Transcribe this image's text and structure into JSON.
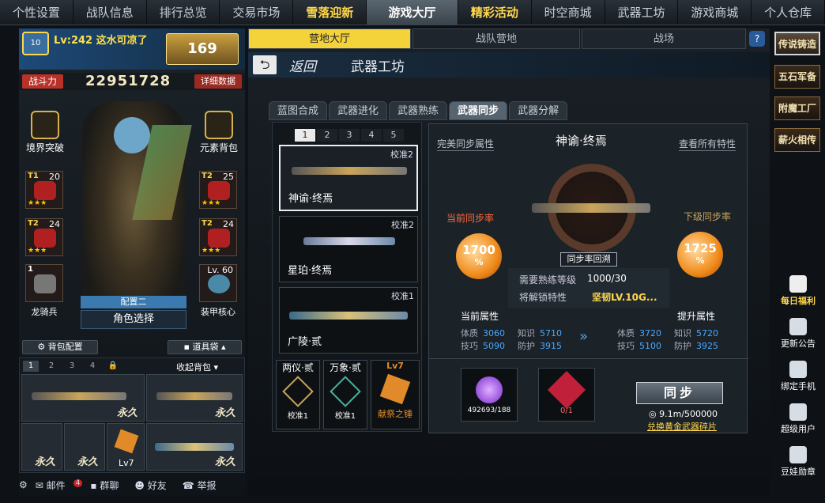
{
  "top_nav": [
    "个性设置",
    "战队信息",
    "排行总览",
    "交易市场",
    "雪落迎新",
    "游戏大厅",
    "精彩活动",
    "时空商城",
    "武器工坊",
    "游戏商城",
    "个人仓库"
  ],
  "player": {
    "level_name": "Lv:242 这水可凉了",
    "rank_num": "10",
    "military": "169",
    "power_label": "战斗力",
    "power_value": "22951728",
    "detail_btn": "详细数据"
  },
  "left_icons": {
    "realm": "境界突破",
    "element": "元素背包"
  },
  "armor_slots": [
    {
      "tier": "T1",
      "num": "20",
      "stars": "★★★"
    },
    {
      "tier": "T2",
      "num": "25",
      "stars": "★★★"
    },
    {
      "tier": "T2",
      "num": "24",
      "stars": "★★★"
    },
    {
      "tier": "T2",
      "num": "24",
      "stars": "★★★"
    }
  ],
  "dragon_rider": {
    "num": "1",
    "label": "龙骑兵"
  },
  "armor_core": {
    "level": "Lv. 60",
    "label": "装甲核心"
  },
  "config": "配置二",
  "role_select": "角色选择",
  "bag_config": "背包配置",
  "tool_bag": "道具袋",
  "bag_tabs": [
    "1",
    "2",
    "3",
    "4"
  ],
  "collapse_bag": "收起背包",
  "perm": "永久",
  "bag_lv": "Lv7",
  "bottom": {
    "mail": "邮件",
    "mail_badge": "4",
    "group": "群聊",
    "friends": "好友",
    "report": "举报"
  },
  "sub_tabs": [
    "营地大厅",
    "战队营地",
    "战场"
  ],
  "help": "?",
  "back": "返回",
  "page_title": "武器工坊",
  "weapon_tabs": [
    "蓝图合成",
    "武器进化",
    "武器熟练",
    "武器同步",
    "武器分解"
  ],
  "page_tabs": [
    "1",
    "2",
    "3",
    "4",
    "5"
  ],
  "weapons": [
    {
      "name": "神谕·终焉",
      "cal": "校准2"
    },
    {
      "name": "星珀·终焉",
      "cal": "校准2"
    },
    {
      "name": "广陵·贰",
      "cal": "校准1"
    }
  ],
  "small_items": [
    {
      "name": "两仪·贰",
      "cal": "校准1"
    },
    {
      "name": "万象·贰",
      "cal": "校准1"
    },
    {
      "name": "献祭之锤",
      "lv": "Lv7"
    }
  ],
  "detail": {
    "perfect_attr": "完美同步属性",
    "name": "神谕·终焉",
    "view_all": "查看所有特性",
    "cur_rate_label": "当前同步率",
    "next_rate_label": "下级同步率",
    "cur_rate": "1700",
    "next_rate": "1725",
    "pct": "%",
    "rollback": "同步率回溯",
    "req_label": "需要熟练等级",
    "req_value": "1000/30",
    "unlock_label": "将解锁特性",
    "unlock_value": "坚韧LV.10G...",
    "cur_attr": "当前属性",
    "up_attr": "提升属性",
    "cur": [
      [
        "体质",
        "3060"
      ],
      [
        "知识",
        "5710"
      ],
      [
        "技巧",
        "5090"
      ],
      [
        "防护",
        "3915"
      ]
    ],
    "up": [
      [
        "体质",
        "3720"
      ],
      [
        "知识",
        "5720"
      ],
      [
        "技巧",
        "5100"
      ],
      [
        "防护",
        "3925"
      ]
    ],
    "mat1": "492693/188",
    "mat2": "0/1",
    "sync_btn": "同步",
    "currency": "9.1m/500000",
    "exchange": "兑换黄金武器碎片"
  },
  "right_buttons": [
    "传说铸造",
    "五石军备",
    "附魔工厂",
    "薪火相传"
  ],
  "right_icons": [
    "每日福利",
    "更新公告",
    "绑定手机",
    "超级用户",
    "豆娃勋章"
  ],
  "colors": {
    "accent": "#f4d23a",
    "orange": "#f08a1a",
    "blue_value": "#4aa8ff",
    "red": "#b8322a"
  }
}
